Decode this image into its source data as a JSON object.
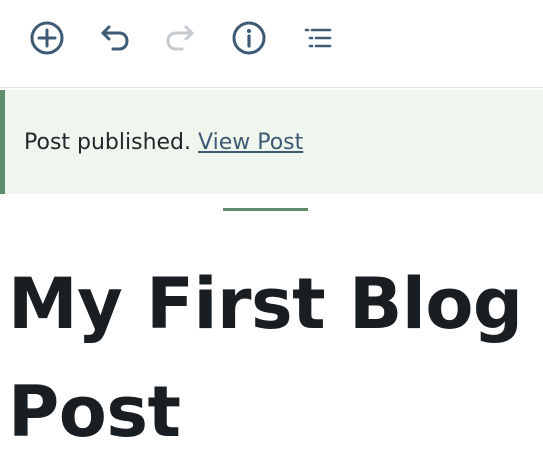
{
  "toolbar": {
    "icons": [
      "add-block-icon",
      "undo-icon",
      "redo-icon",
      "info-icon",
      "list-view-icon"
    ],
    "icon_color": "#3e5a75",
    "disabled_color": "#c6cbd0"
  },
  "notice": {
    "message": "Post published.",
    "link_text": "View Post",
    "background": "#eef6ee",
    "accent": "#5f8d6e"
  },
  "post": {
    "title": "My First Blog Post"
  }
}
